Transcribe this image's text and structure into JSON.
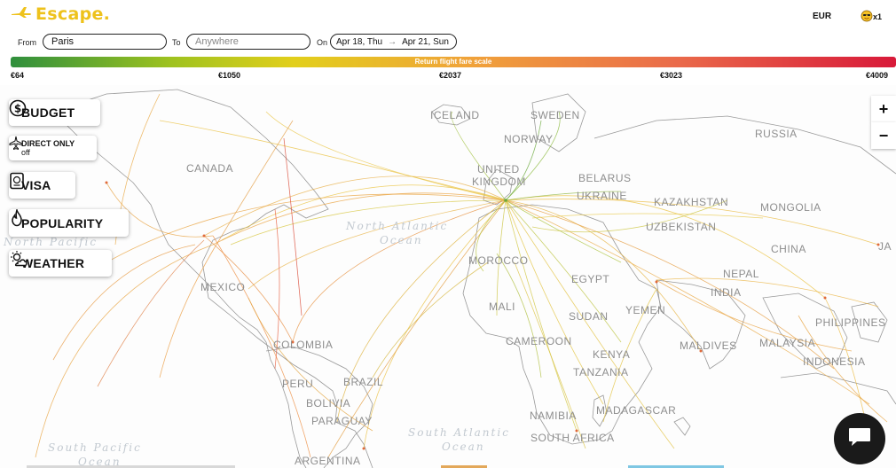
{
  "header": {
    "logo_text": "Escape.",
    "currency": "EUR",
    "travellers": "x1"
  },
  "search": {
    "from_label": "From",
    "from_value": "Paris",
    "to_label": "To",
    "to_placeholder": "Anywhere",
    "on_label": "On",
    "date_start": "Apr 18, Thu",
    "date_arrow": "→",
    "date_end": "Apr 21, Sun"
  },
  "fare_scale": {
    "title": "Return flight fare scale",
    "ticks": [
      "€64",
      "€1050",
      "€2037",
      "€3023",
      "€4009"
    ],
    "colors": [
      "#2f8f3d",
      "#9ec21f",
      "#e2cf1b",
      "#f0a23a",
      "#ea6b4a",
      "#d81939"
    ]
  },
  "filters": {
    "budget": "BUDGET",
    "direct_only": "DIRECT ONLY",
    "direct_only_state": "off",
    "visa": "VISA",
    "popularity": "POPULARITY",
    "weather": "WEATHER"
  },
  "zoom": {
    "in": "+",
    "out": "−"
  },
  "map": {
    "countries": [
      "ICELAND",
      "SWEDEN",
      "NORWAY",
      "RUSSIA",
      "CANADA",
      "UNITED",
      "KINGDOM",
      "BELARUS",
      "UKRAINE",
      "KAZAKHSTAN",
      "MONGOLIA",
      "UZBEKISTAN",
      "CHINA",
      "JA",
      "NEPAL",
      "INDIA",
      "PHILIPPINES",
      "MALAYSIA",
      "MEXICO",
      "MOROCCO",
      "MALI",
      "SUDAN",
      "YEMEN",
      "EGYPT",
      "CAMEROON",
      "KENYA",
      "TANZANIA",
      "MALDIVES",
      "COLOMBIA",
      "PERU",
      "BRAZIL",
      "BOLIVIA",
      "PARAGUAY",
      "NAMIBIA",
      "MADAGASCAR",
      "SOUTH AFRICA",
      "ARGENTINA",
      "INDONESIA"
    ],
    "oceans": {
      "north_pacific": "North Pacific",
      "north_atlantic_1": "North Atlantic",
      "north_atlantic_2": "Ocean",
      "south_atlantic_1": "South Atlantic",
      "south_atlantic_2": "Ocean",
      "south_pacific_1": "South Pacific",
      "south_pacific_2": "Ocean"
    }
  }
}
